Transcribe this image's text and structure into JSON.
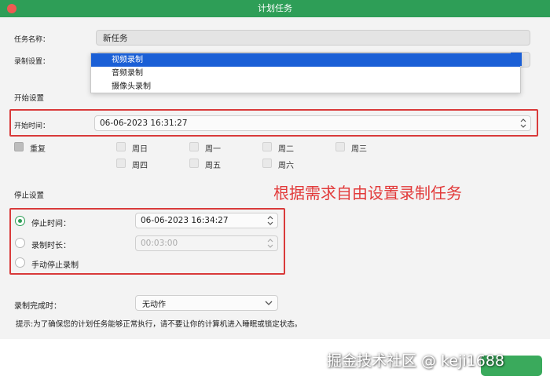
{
  "window": {
    "title": "计划任务"
  },
  "task": {
    "name_label": "任务名称：",
    "name_value": "新任务",
    "mode_label": "录制设置：",
    "mode_options": [
      "视频录制",
      "音频录制",
      "摄像头录制"
    ]
  },
  "start": {
    "section_label": "开始设置",
    "time_label": "开始时间：",
    "time_value": "06-06-2023 16:31:27",
    "repeat_label": "重复",
    "days": [
      "周日",
      "周一",
      "周二",
      "周三",
      "周四",
      "周五",
      "周六"
    ]
  },
  "stop": {
    "section_label": "停止设置",
    "stop_time_label": "停止时间：",
    "stop_time_value": "06-06-2023 16:34:27",
    "duration_label": "录制时长：",
    "duration_value": "00:03:00",
    "manual_label": "手动停止录制",
    "selected": "停止时间"
  },
  "complete": {
    "label": "录制完成时：",
    "value": "无动作"
  },
  "tip": "提示:为了确保您的计划任务能够正常执行，请不要让你的计算机进入睡眠或锁定状态。",
  "annotation": "根据需求自由设置录制任务",
  "watermark": "掘金技术社区 @ keji1688",
  "colors": {
    "accent": "#2e9e57",
    "highlight": "#d93a3a",
    "selection": "#1a5fd6"
  }
}
